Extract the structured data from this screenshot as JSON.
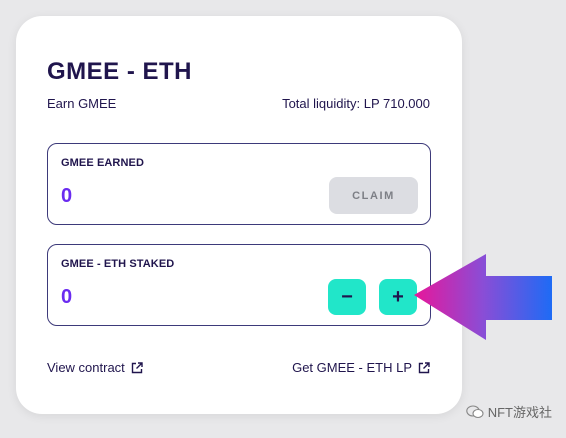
{
  "pool": {
    "title": "GMEE - ETH",
    "earn_label": "Earn GMEE",
    "total_liquidity": "Total liquidity: LP 710.000"
  },
  "earned": {
    "label": "GMEE EARNED",
    "value": "0",
    "claim_label": "CLAIM"
  },
  "staked": {
    "label": "GMEE - ETH STAKED",
    "value": "0",
    "minus_label": "−",
    "plus_label": "+"
  },
  "links": {
    "view_contract": "View contract",
    "get_lp": "Get GMEE - ETH LP"
  },
  "annotation": {
    "arrow_colors": [
      "#e8169a",
      "#8a4dd6",
      "#1e6bf5"
    ]
  },
  "watermark": {
    "text": "NFT游戏社"
  }
}
